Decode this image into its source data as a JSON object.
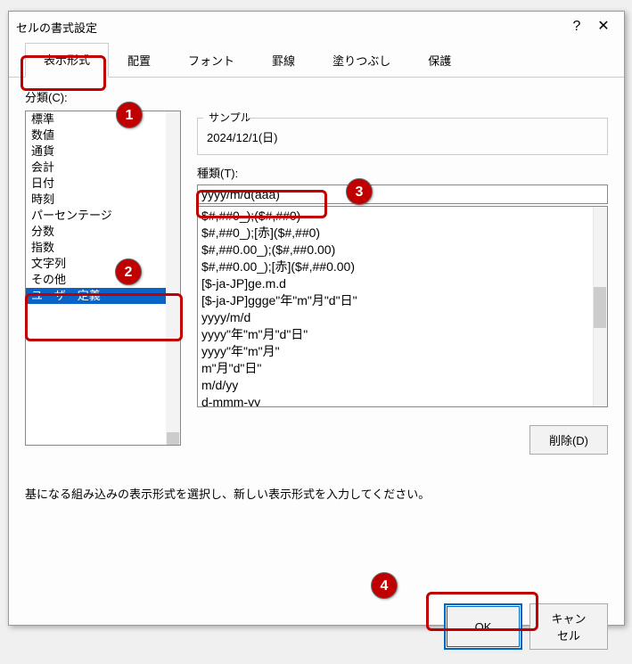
{
  "titlebar": {
    "title": "セルの書式設定",
    "help": "?",
    "close": "✕"
  },
  "tabs": {
    "items": [
      {
        "label": "表示形式",
        "active": true
      },
      {
        "label": "配置",
        "active": false
      },
      {
        "label": "フォント",
        "active": false
      },
      {
        "label": "罫線",
        "active": false
      },
      {
        "label": "塗りつぶし",
        "active": false
      },
      {
        "label": "保護",
        "active": false
      }
    ]
  },
  "category": {
    "label": "分類(C):",
    "items": [
      "標準",
      "数値",
      "通貨",
      "会計",
      "日付",
      "時刻",
      "パーセンテージ",
      "分数",
      "指数",
      "文字列",
      "その他",
      "ユーザー定義"
    ],
    "selected": "ユーザー定義"
  },
  "sample": {
    "legend": "サンプル",
    "value": "2024/12/1(日)"
  },
  "type": {
    "label": "種類(T):",
    "value": "yyyy/m/d(aaa)"
  },
  "format_list": {
    "items": [
      "$#,##0_);($#,##0)",
      "$#,##0_);[赤]($#,##0)",
      "$#,##0.00_);($#,##0.00)",
      "$#,##0.00_);[赤]($#,##0.00)",
      "[$-ja-JP]ge.m.d",
      "[$-ja-JP]ggge\"年\"m\"月\"d\"日\"",
      "yyyy/m/d",
      "yyyy\"年\"m\"月\"d\"日\"",
      "yyyy\"年\"m\"月\"",
      "m\"月\"d\"日\"",
      "m/d/yy",
      "d-mmm-yy"
    ]
  },
  "delete": {
    "label": "削除(D)"
  },
  "hint": "基になる組み込みの表示形式を選択し、新しい表示形式を入力してください。",
  "buttons": {
    "ok": "OK",
    "cancel": "キャンセル"
  },
  "callouts": {
    "c1": "1",
    "c2": "2",
    "c3": "3",
    "c4": "4"
  }
}
